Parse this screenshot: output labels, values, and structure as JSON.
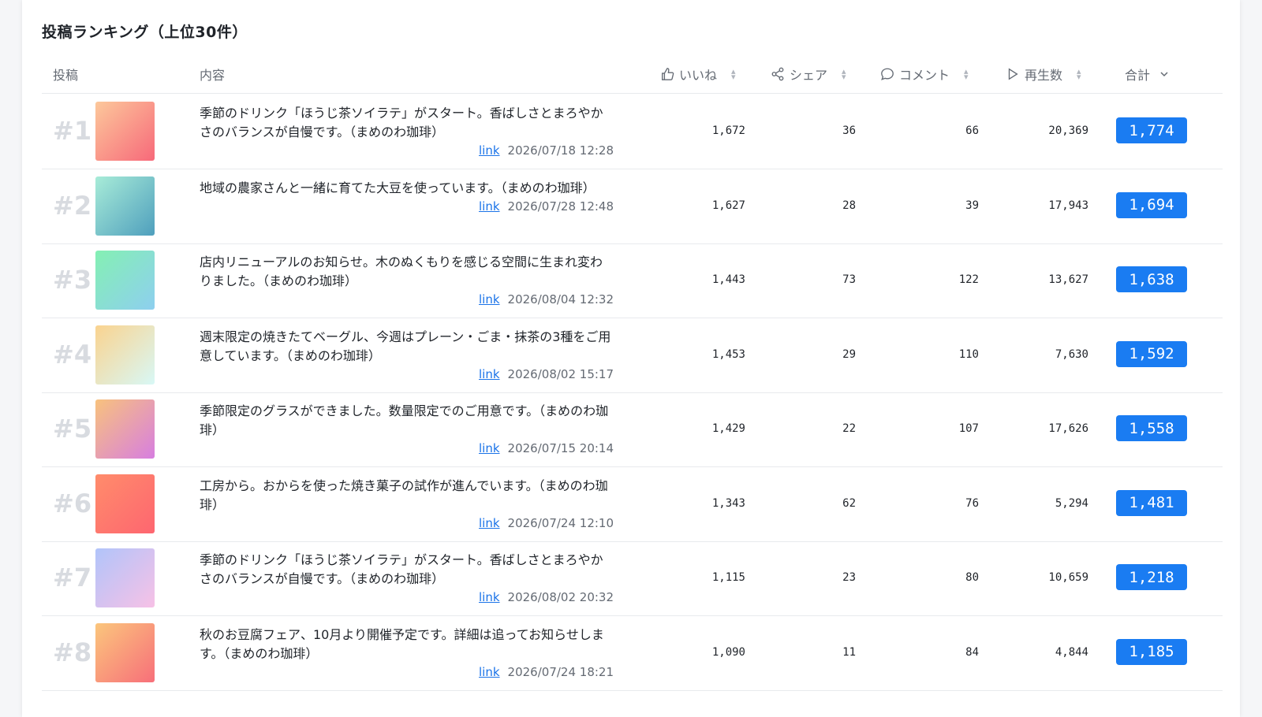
{
  "title": "投稿ランキング（上位30件）",
  "columns": {
    "post": "投稿",
    "content": "内容",
    "likes": "いいね",
    "shares": "シェア",
    "comments": "コメント",
    "plays": "再生数",
    "total": "合計"
  },
  "link_label": "link",
  "rows": [
    {
      "rank": "#1",
      "text": "季節のドリンク「ほうじ茶ソイラテ」がスタート。香ばしさとまろやかさのバランスが自慢です。（まめのわ珈琲）",
      "date": "2026/07/18 12:28",
      "likes": "1,672",
      "shares": "36",
      "comments": "66",
      "plays": "20,369",
      "total": "1,774",
      "c1": "#fcc89b",
      "c2": "#f7697a"
    },
    {
      "rank": "#2",
      "text": "地域の農家さんと一緒に育てた大豆を使っています。（まめのわ珈琲）",
      "date": "2026/07/28 12:48",
      "likes": "1,627",
      "shares": "28",
      "comments": "39",
      "plays": "17,943",
      "total": "1,694",
      "c1": "#a8ecd8",
      "c2": "#4f9fbd"
    },
    {
      "rank": "#3",
      "text": "店内リニューアルのお知らせ。木のぬくもりを感じる空間に生まれ変わりました。（まめのわ珈琲）",
      "date": "2026/08/04 12:32",
      "likes": "1,443",
      "shares": "73",
      "comments": "122",
      "plays": "13,627",
      "total": "1,638",
      "c1": "#84f0b3",
      "c2": "#8ecfef"
    },
    {
      "rank": "#4",
      "text": "週末限定の焼きたてベーグル、今週はプレーン・ごま・抹茶の3種をご用意しています。（まめのわ珈琲）",
      "date": "2026/08/02 15:17",
      "likes": "1,453",
      "shares": "29",
      "comments": "110",
      "plays": "7,630",
      "total": "1,592",
      "c1": "#fad38f",
      "c2": "#d8f8f6"
    },
    {
      "rank": "#5",
      "text": "季節限定のグラスができました。数量限定でのご用意です。（まめのわ珈琲）",
      "date": "2026/07/15 20:14",
      "likes": "1,429",
      "shares": "22",
      "comments": "107",
      "plays": "17,626",
      "total": "1,558",
      "c1": "#f8c27d",
      "c2": "#d77ee0"
    },
    {
      "rank": "#6",
      "text": "工房から。おからを使った焼き菓子の試作が進んでいます。（まめのわ珈琲）",
      "date": "2026/07/24 12:10",
      "likes": "1,343",
      "shares": "62",
      "comments": "76",
      "plays": "5,294",
      "total": "1,481",
      "c1": "#ff8c6b",
      "c2": "#fe6670"
    },
    {
      "rank": "#7",
      "text": "季節のドリンク「ほうじ茶ソイラテ」がスタート。香ばしさとまろやかさのバランスが自慢です。（まめのわ珈琲）",
      "date": "2026/08/02 20:32",
      "likes": "1,115",
      "shares": "23",
      "comments": "80",
      "plays": "10,659",
      "total": "1,218",
      "c1": "#b1c4fa",
      "c2": "#f7c1e6"
    },
    {
      "rank": "#8",
      "text": "秋のお豆腐フェア、10月より開催予定です。詳細は追ってお知らせします。（まめのわ珈琲）",
      "date": "2026/07/24 18:21",
      "likes": "1,090",
      "shares": "11",
      "comments": "84",
      "plays": "4,844",
      "total": "1,185",
      "c1": "#fbc67c",
      "c2": "#f76f7a"
    }
  ]
}
